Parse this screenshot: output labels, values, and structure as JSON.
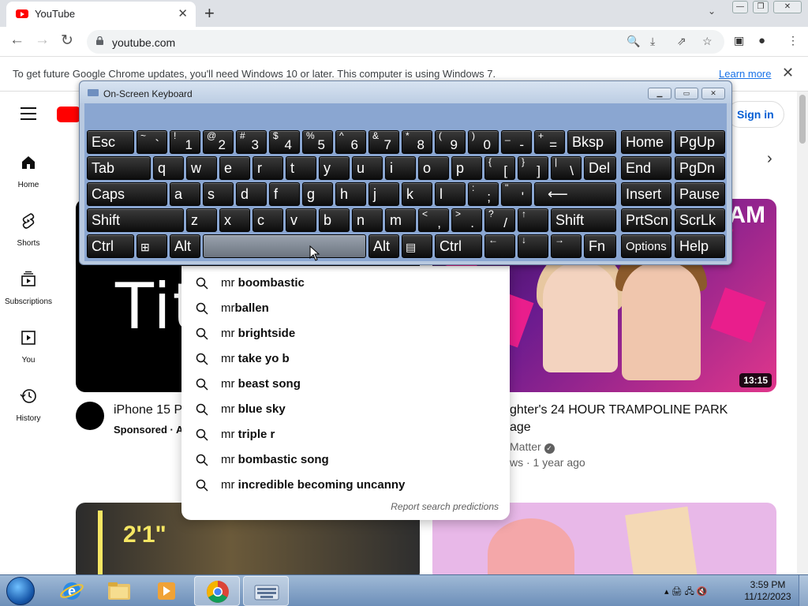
{
  "browser": {
    "tab_title": "YouTube",
    "url": "youtube.com",
    "infobar_message": "To get future Google Chrome updates, you'll need Windows 10 or later. This computer is using Windows 7.",
    "infobar_link": "Learn more"
  },
  "youtube": {
    "signin_label": "Sign in",
    "nav": [
      {
        "label": "Home",
        "icon": "home-icon"
      },
      {
        "label": "Shorts",
        "icon": "shorts-icon"
      },
      {
        "label": "Subscriptions",
        "icon": "subscriptions-icon"
      },
      {
        "label": "You",
        "icon": "you-icon"
      },
      {
        "label": "History",
        "icon": "history-icon"
      }
    ],
    "videos": [
      {
        "title": "iPhone 15 P",
        "meta": "Sponsored · A"
      },
      {
        "title_line1": "ghter's 24 HOUR TRAMPOLINE PARK",
        "title_line2": "age",
        "channel": "Matter",
        "meta": "ws · 1 year ago",
        "duration": "13:15",
        "thumb_text": "AM"
      }
    ],
    "thumb1_text": "Tit",
    "thumb3_text": "2'1\""
  },
  "suggestions": {
    "prefix": "mr",
    "items": [
      {
        "prefix": "mr ",
        "rest": "boombastic"
      },
      {
        "prefix": "mr",
        "rest": "ballen"
      },
      {
        "prefix": "mr ",
        "rest": "brightside"
      },
      {
        "prefix": "mr ",
        "rest": "take yo b"
      },
      {
        "prefix": "mr ",
        "rest": "beast song"
      },
      {
        "prefix": "mr ",
        "rest": "blue sky"
      },
      {
        "prefix": "mr ",
        "rest": "triple r"
      },
      {
        "prefix": "mr ",
        "rest": "bombastic song"
      },
      {
        "prefix": "mr ",
        "rest": "incredible becoming uncanny"
      }
    ],
    "report_label": "Report search predictions"
  },
  "osk": {
    "title": "On-Screen Keyboard",
    "keys": {
      "esc": "Esc",
      "bksp": "Bksp",
      "home": "Home",
      "pgup": "PgUp",
      "tab": "Tab",
      "del": "Del",
      "end": "End",
      "pgdn": "PgDn",
      "caps": "Caps",
      "insert": "Insert",
      "pause": "Pause",
      "shift": "Shift",
      "prtscn": "PrtScn",
      "scrlk": "ScrLk",
      "ctrl": "Ctrl",
      "alt": "Alt",
      "fn": "Fn",
      "options": "Options",
      "help": "Help"
    }
  },
  "taskbar": {
    "time": "3:59 PM",
    "date": "11/12/2023"
  }
}
